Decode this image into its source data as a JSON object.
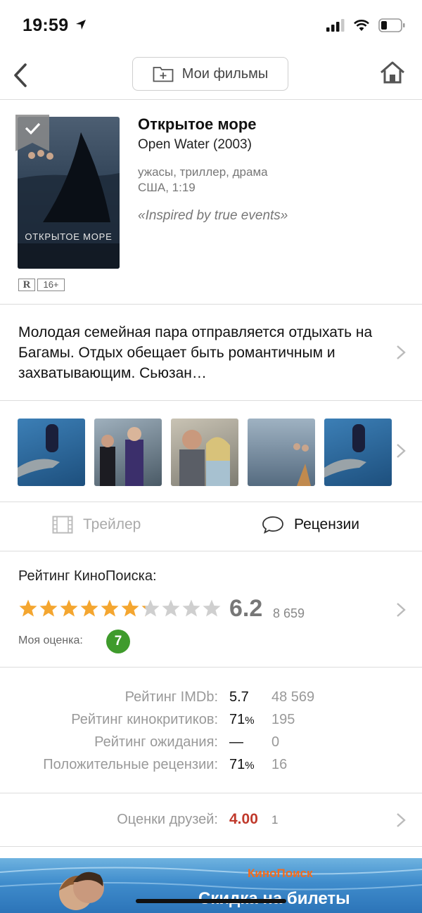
{
  "status": {
    "time": "19:59",
    "icons": [
      "location-arrow-icon",
      "signal-icon",
      "wifi-icon",
      "battery-icon"
    ]
  },
  "nav": {
    "my_films_label": "Мои фильмы",
    "icons": [
      "back-icon",
      "folder-add-icon",
      "home-icon"
    ]
  },
  "film": {
    "title": "Открытое море",
    "original_title": "Open Water (2003)",
    "genres": "ужасы, триллер, драма",
    "country_duration": "США, 1:19",
    "tagline": "«Inspired by true events»",
    "poster_title": "ОТКРЫТОЕ МОРЕ",
    "mpaa": "R",
    "age": "16+"
  },
  "description": "Молодая семейная пара отправляется отдыхать на Багамы. Отдых обещает быть романтичным и захватывающим. Сьюзан…",
  "actions": {
    "trailer_label": "Трейлер",
    "reviews_label": "Рецензии"
  },
  "kp_rating": {
    "label": "Рейтинг КиноПоиска:",
    "score": "6.2",
    "votes": "8 659",
    "stars_total": 10,
    "stars_filled": 6.2,
    "my_rating_label": "Моя оценка:",
    "my_rating": "7"
  },
  "ratings": [
    {
      "label": "Рейтинг IMDb:",
      "value": "5.7",
      "suffix": "",
      "count": "48 569"
    },
    {
      "label": "Рейтинг кинокритиков:",
      "value": "71",
      "suffix": "%",
      "count": "195"
    },
    {
      "label": "Рейтинг ожидания:",
      "value": "—",
      "suffix": "",
      "count": "0"
    },
    {
      "label": "Положительные рецензии:",
      "value": "71",
      "suffix": "%",
      "count": "16"
    }
  ],
  "friends": {
    "label": "Оценки друзей:",
    "score": "4.00",
    "count": "1"
  },
  "banner": {
    "brand": "КиноПоиск",
    "text": "Скидка на билеты"
  },
  "colors": {
    "star": "#f4a630",
    "star_empty": "#cfcfcf",
    "my_rating_bg": "#3f9b2c",
    "friends_score": "#c0392b",
    "brand": "#f36b1c"
  }
}
